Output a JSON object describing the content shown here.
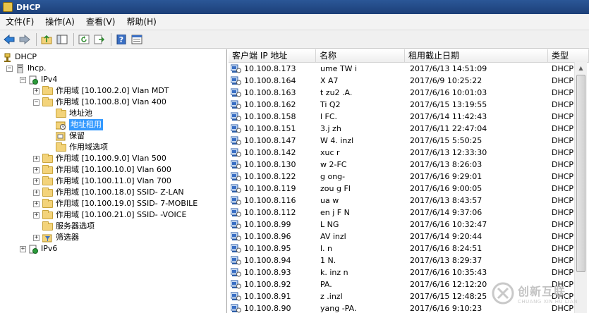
{
  "window": {
    "title": "DHCP"
  },
  "menu": [
    "文件(F)",
    "操作(A)",
    "查看(V)",
    "帮助(H)"
  ],
  "toolbar": [
    "back-icon",
    "forward-icon",
    "up-folder-icon",
    "show-tree-icon",
    "refresh-icon",
    "export-icon",
    "help-icon",
    "properties-icon"
  ],
  "tree": {
    "root": "DHCP",
    "server": "lhcp.",
    "ipv4": "IPv4",
    "scopes_top": [
      "作用域 [10.100.2.0] Vlan MDT",
      "作用域 [10.100.8.0] Vlan 400"
    ],
    "scope_children": [
      "地址池",
      "地址租用",
      "保留",
      "作用域选项"
    ],
    "scopes_bottom": [
      "作用域 [10.100.9.0] Vlan 500",
      "作用域 [10.100.10.0] Vlan 600",
      "作用域 [10.100.11.0] Vlan 700",
      "作用域 [10.100.18.0] SSID-  Z-LAN",
      "作用域 [10.100.19.0] SSID-  7-MOBILE",
      "作用域 [10.100.21.0] SSID-  -VOICE"
    ],
    "server_options": "服务器选项",
    "filters": "筛选器",
    "ipv6": "IPv6"
  },
  "list": {
    "columns": [
      "客户端 IP 地址",
      "名称",
      "租用截止日期",
      "类型"
    ],
    "rows": [
      {
        "ip": "10.100.8.173",
        "name": "ume   TW i",
        "expiry": "2017/6/13 14:51:09",
        "type": "DHCP"
      },
      {
        "ip": "10.100.8.164",
        "name": "X   A7",
        "expiry": "2017/6/9 10:25:22",
        "type": "DHCP"
      },
      {
        "ip": "10.100.8.163",
        "name": "t   zu2 .A.",
        "expiry": "2017/6/16 10:01:03",
        "type": "DHCP"
      },
      {
        "ip": "10.100.8.162",
        "name": "Ti   Q2",
        "expiry": "2017/6/15 13:19:55",
        "type": "DHCP"
      },
      {
        "ip": "10.100.8.158",
        "name": "l   FC.",
        "expiry": "2017/6/14 11:42:43",
        "type": "DHCP"
      },
      {
        "ip": "10.100.8.151",
        "name": "3.j zh",
        "expiry": "2017/6/11 22:47:04",
        "type": "DHCP"
      },
      {
        "ip": "10.100.8.147",
        "name": "W   4.  inzl",
        "expiry": "2017/6/15 5:50:25",
        "type": "DHCP"
      },
      {
        "ip": "10.100.8.142",
        "name": "xuc   r",
        "expiry": "2017/6/13 12:33:30",
        "type": "DHCP"
      },
      {
        "ip": "10.100.8.130",
        "name": "w   2-FC",
        "expiry": "2017/6/13 8:26:03",
        "type": "DHCP"
      },
      {
        "ip": "10.100.8.122",
        "name": "g   ong-",
        "expiry": "2017/6/16 9:29:01",
        "type": "DHCP"
      },
      {
        "ip": "10.100.8.119",
        "name": "zou   g FI",
        "expiry": "2017/6/16 9:00:05",
        "type": "DHCP"
      },
      {
        "ip": "10.100.8.116",
        "name": "ua   w",
        "expiry": "2017/6/13 8:43:57",
        "type": "DHCP"
      },
      {
        "ip": "10.100.8.112",
        "name": "en j   F N",
        "expiry": "2017/6/14 9:37:06",
        "type": "DHCP"
      },
      {
        "ip": "10.100.8.99",
        "name": "L   NG",
        "expiry": "2017/6/16 10:32:47",
        "type": "DHCP"
      },
      {
        "ip": "10.100.8.96",
        "name": "AV   inzl",
        "expiry": "2017/6/14 9:20:44",
        "type": "DHCP"
      },
      {
        "ip": "10.100.8.95",
        "name": "l.   n",
        "expiry": "2017/6/16 8:24:51",
        "type": "DHCP"
      },
      {
        "ip": "10.100.8.94",
        "name": "1   N.",
        "expiry": "2017/6/13 8:29:37",
        "type": "DHCP"
      },
      {
        "ip": "10.100.8.93",
        "name": "k.  inz   n",
        "expiry": "2017/6/16 10:35:43",
        "type": "DHCP"
      },
      {
        "ip": "10.100.8.92",
        "name": "   PA.",
        "expiry": "2017/6/16 12:12:20",
        "type": "DHCP"
      },
      {
        "ip": "10.100.8.91",
        "name": "z   .inzl",
        "expiry": "2017/6/15 12:48:25",
        "type": "DHCP"
      },
      {
        "ip": "10.100.8.90",
        "name": "yang   -PA.",
        "expiry": "2017/6/16 9:10:23",
        "type": "DHCP"
      }
    ]
  },
  "watermark": {
    "main": "创新互联",
    "sub": "CHUANG XIN HU LIAN"
  },
  "colors": {
    "titlebar": "#2b5797",
    "selection": "#3399ff",
    "folder": "#f3d37a"
  }
}
